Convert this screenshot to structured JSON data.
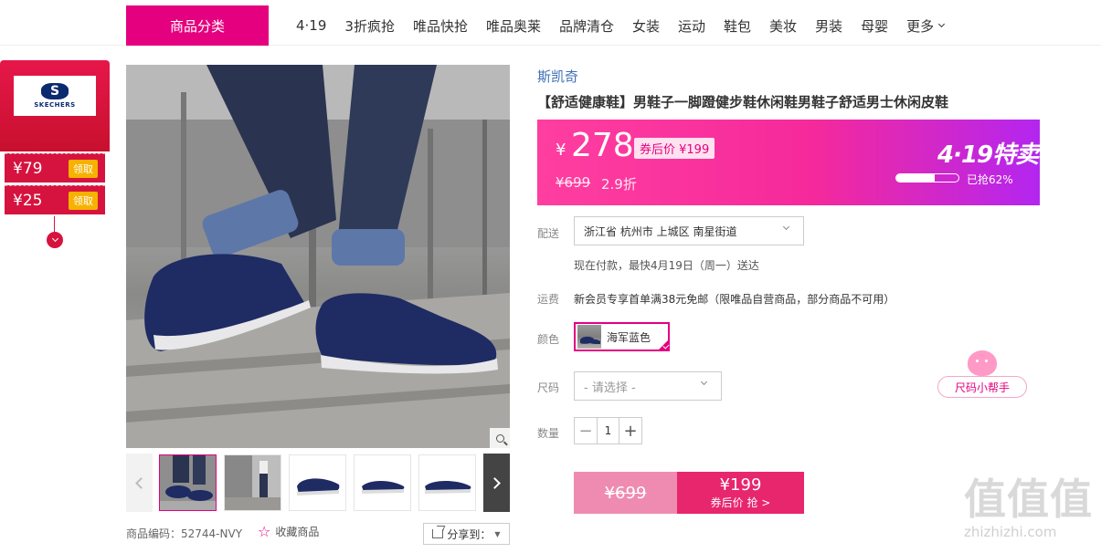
{
  "nav": {
    "category_button": "商品分类",
    "items": [
      "4·19",
      "3折疯抢",
      "唯品快抢",
      "唯品奥莱",
      "品牌清仓",
      "女装",
      "运动",
      "鞋包",
      "美妆",
      "男装",
      "母婴"
    ],
    "more": "更多"
  },
  "brand_widget": {
    "logo_text": "SKECHERS",
    "coupons": [
      {
        "value": "¥79",
        "action": "领取"
      },
      {
        "value": "¥25",
        "action": "领取"
      }
    ]
  },
  "gallery": {
    "sku_text": "商品编码：52744-NVY",
    "favorite": "收藏商品",
    "share": "分享到："
  },
  "product": {
    "brand": "斯凯奇",
    "title": "【舒适健康鞋】男鞋子一脚蹬健步鞋休闲鞋男鞋子舒适男士休闲皮鞋",
    "price": {
      "currency": "¥",
      "current": "278",
      "after_coupon": "券后价 ¥199",
      "original": "¥699",
      "discount": "2.9折",
      "promo": "4·19特卖",
      "sold_text": "已抢62%",
      "sold_fraction": 0.62
    },
    "delivery": {
      "label": "配送",
      "address": "浙江省 杭州市 上城区 南星街道",
      "note": "现在付款，最快4月19日（周一）送达"
    },
    "freight": {
      "label": "运费",
      "text": "新会员专享首单满38元免邮（限唯品自营商品，部分商品不可用）"
    },
    "color": {
      "label": "颜色",
      "selected": "海军蓝色"
    },
    "size": {
      "label": "尺码",
      "placeholder": "- 请选择 -",
      "helper": "尺码小帮手"
    },
    "quantity": {
      "label": "数量",
      "value": "1",
      "minus": "−",
      "plus": "+"
    },
    "buy": {
      "original": "¥699",
      "price": "¥199",
      "sub": "券后价 抢 >"
    }
  },
  "watermark": {
    "logo": "值值值",
    "url": "zhizhizhi.com"
  },
  "colors": {
    "accent": "#e4007f",
    "coupon_red": "#d6133e",
    "brand_link": "#3f6fb6"
  }
}
